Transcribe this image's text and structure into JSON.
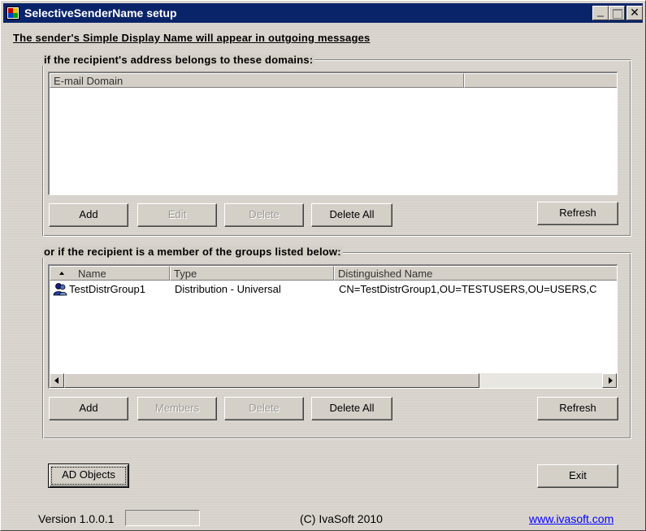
{
  "window": {
    "title": "SelectiveSenderName setup",
    "headline": "The sender's Simple Display Name will appear in outgoing messages"
  },
  "domains": {
    "group_label": "if the recipient's address belongs to these domains:",
    "columns": [
      "E-mail Domain",
      ""
    ],
    "rows": [],
    "buttons": {
      "add": "Add",
      "edit": "Edit",
      "delete": "Delete",
      "delete_all": "Delete All",
      "refresh": "Refresh"
    }
  },
  "groups": {
    "group_label": "or if the recipient is a member of the groups listed below:",
    "columns": [
      "Name",
      "Type",
      "Distinguished Name"
    ],
    "sort_column": "Name",
    "rows": [
      {
        "name": "TestDistrGroup1",
        "type": "Distribution - Universal",
        "dn": "CN=TestDistrGroup1,OU=TESTUSERS,OU=USERS,C"
      }
    ],
    "buttons": {
      "add": "Add",
      "members": "Members",
      "delete": "Delete",
      "delete_all": "Delete All",
      "refresh": "Refresh"
    }
  },
  "footer": {
    "ad_objects": "AD Objects",
    "exit": "Exit",
    "version": "Version 1.0.0.1",
    "copyright": "(C) IvaSoft 2010",
    "website": "www.ivasoft.com"
  },
  "colors": {
    "titlebar": "#0a246a",
    "face": "#d4d0c8",
    "link": "#0000ff"
  }
}
